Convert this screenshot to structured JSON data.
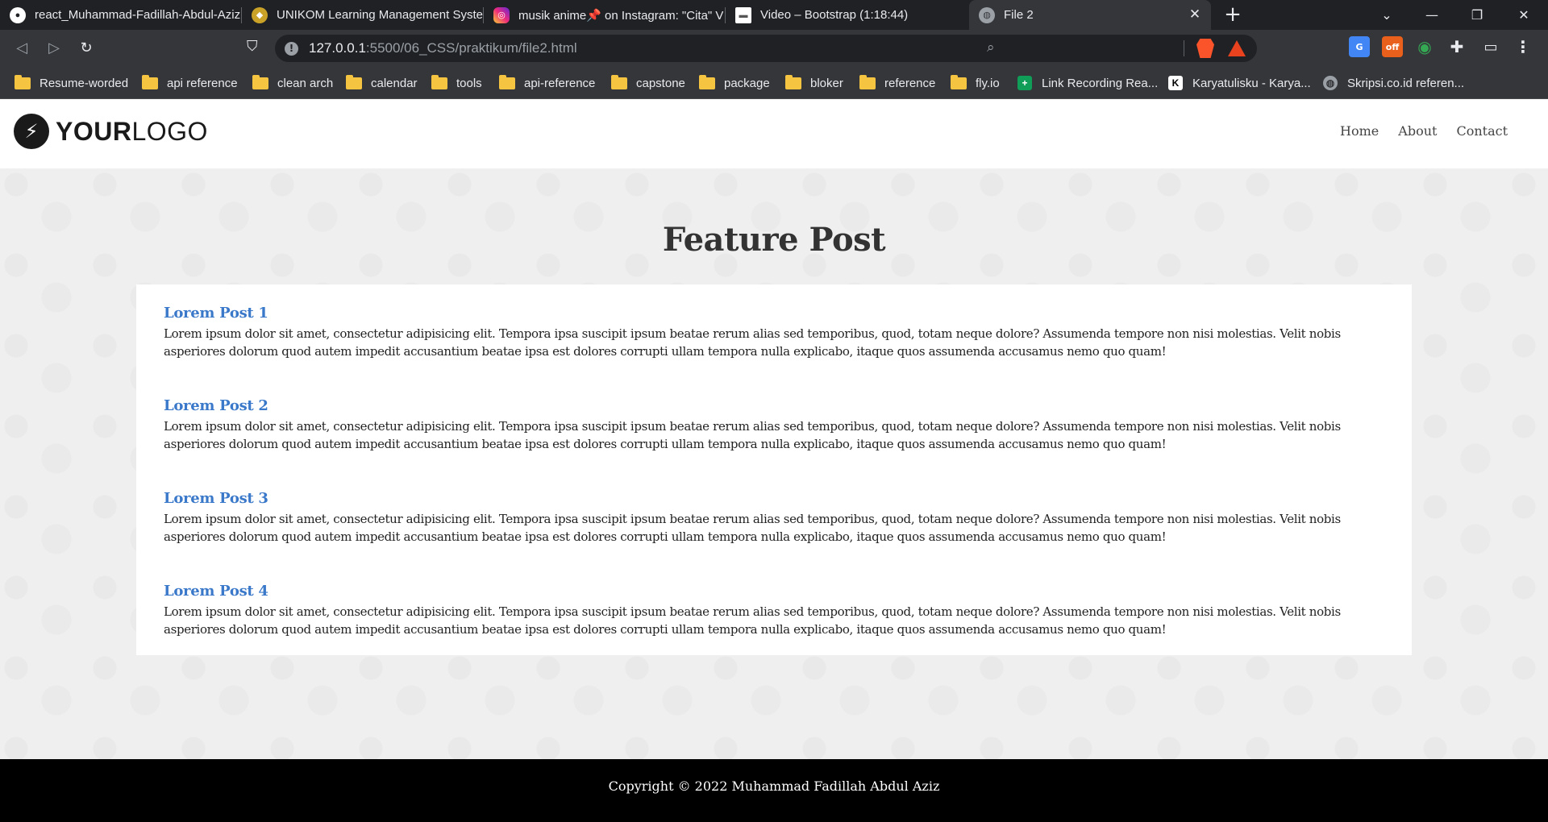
{
  "browser": {
    "tabs": [
      {
        "title": "react_Muhammad-Fadillah-Abdul-Aziz",
        "favicon": "github-icon",
        "color": "#ffffff"
      },
      {
        "title": "UNIKOM Learning Management Syste",
        "favicon": "unikom-icon",
        "color": "#c9a227"
      },
      {
        "title": "musik anime📌 on Instagram: \"Cita\" V",
        "favicon": "instagram-icon",
        "color": "#e1306c"
      },
      {
        "title": "Video – Bootstrap (1:18:44)",
        "favicon": "video-icon",
        "color": "#ffffff"
      },
      {
        "title": "File 2",
        "favicon": "globe-icon",
        "color": "#9aa0a6"
      }
    ],
    "address": {
      "host": "127.0.0.1",
      "path": ":5500/06_CSS/praktikum/file2.html"
    },
    "bookmarks": [
      {
        "label": "Resume-worded",
        "icon": "folder-icon"
      },
      {
        "label": "api reference",
        "icon": "folder-icon"
      },
      {
        "label": "clean arch",
        "icon": "folder-icon"
      },
      {
        "label": "calendar",
        "icon": "folder-icon"
      },
      {
        "label": "tools",
        "icon": "folder-icon"
      },
      {
        "label": "api-reference",
        "icon": "folder-icon"
      },
      {
        "label": "capstone",
        "icon": "folder-icon"
      },
      {
        "label": "package",
        "icon": "folder-icon"
      },
      {
        "label": "bloker",
        "icon": "folder-icon"
      },
      {
        "label": "reference",
        "icon": "folder-icon"
      },
      {
        "label": "fly.io",
        "icon": "folder-icon"
      },
      {
        "label": "Link Recording Rea...",
        "icon": "sheets-icon"
      },
      {
        "label": "Karyatulisku - Karya...",
        "icon": "k-icon"
      },
      {
        "label": "Skripsi.co.id referen...",
        "icon": "globe-icon"
      }
    ]
  },
  "site": {
    "logo": {
      "bold": "YOUR",
      "light": "LOGO"
    },
    "nav": [
      "Home",
      "About",
      "Contact"
    ],
    "heading": "Feature Post",
    "posts": [
      {
        "title": "Lorem Post 1",
        "body": "Lorem ipsum dolor sit amet, consectetur adipisicing elit. Tempora ipsa suscipit ipsum beatae rerum alias sed temporibus, quod, totam neque dolore? Assumenda tempore non nisi molestias. Velit nobis asperiores dolorum quod autem impedit accusantium beatae ipsa est dolores corrupti ullam tempora nulla explicabo, itaque quos assumenda accusamus nemo quo quam!"
      },
      {
        "title": "Lorem Post 2",
        "body": "Lorem ipsum dolor sit amet, consectetur adipisicing elit. Tempora ipsa suscipit ipsum beatae rerum alias sed temporibus, quod, totam neque dolore? Assumenda tempore non nisi molestias. Velit nobis asperiores dolorum quod autem impedit accusantium beatae ipsa est dolores corrupti ullam tempora nulla explicabo, itaque quos assumenda accusamus nemo quo quam!"
      },
      {
        "title": "Lorem Post 3",
        "body": "Lorem ipsum dolor sit amet, consectetur adipisicing elit. Tempora ipsa suscipit ipsum beatae rerum alias sed temporibus, quod, totam neque dolore? Assumenda tempore non nisi molestias. Velit nobis asperiores dolorum quod autem impedit accusantium beatae ipsa est dolores corrupti ullam tempora nulla explicabo, itaque quos assumenda accusamus nemo quo quam!"
      },
      {
        "title": "Lorem Post 4",
        "body": "Lorem ipsum dolor sit amet, consectetur adipisicing elit. Tempora ipsa suscipit ipsum beatae rerum alias sed temporibus, quod, totam neque dolore? Assumenda tempore non nisi molestias. Velit nobis asperiores dolorum quod autem impedit accusantium beatae ipsa est dolores corrupti ullam tempora nulla explicabo, itaque quos assumenda accusamus nemo quo quam!"
      }
    ],
    "footer": "Copyright © 2022 Muhammad Fadillah Abdul Aziz"
  },
  "colors": {
    "link": "#3a78c9",
    "chrome_dark": "#202124",
    "chrome": "#35363a",
    "folder": "#f5c542"
  }
}
